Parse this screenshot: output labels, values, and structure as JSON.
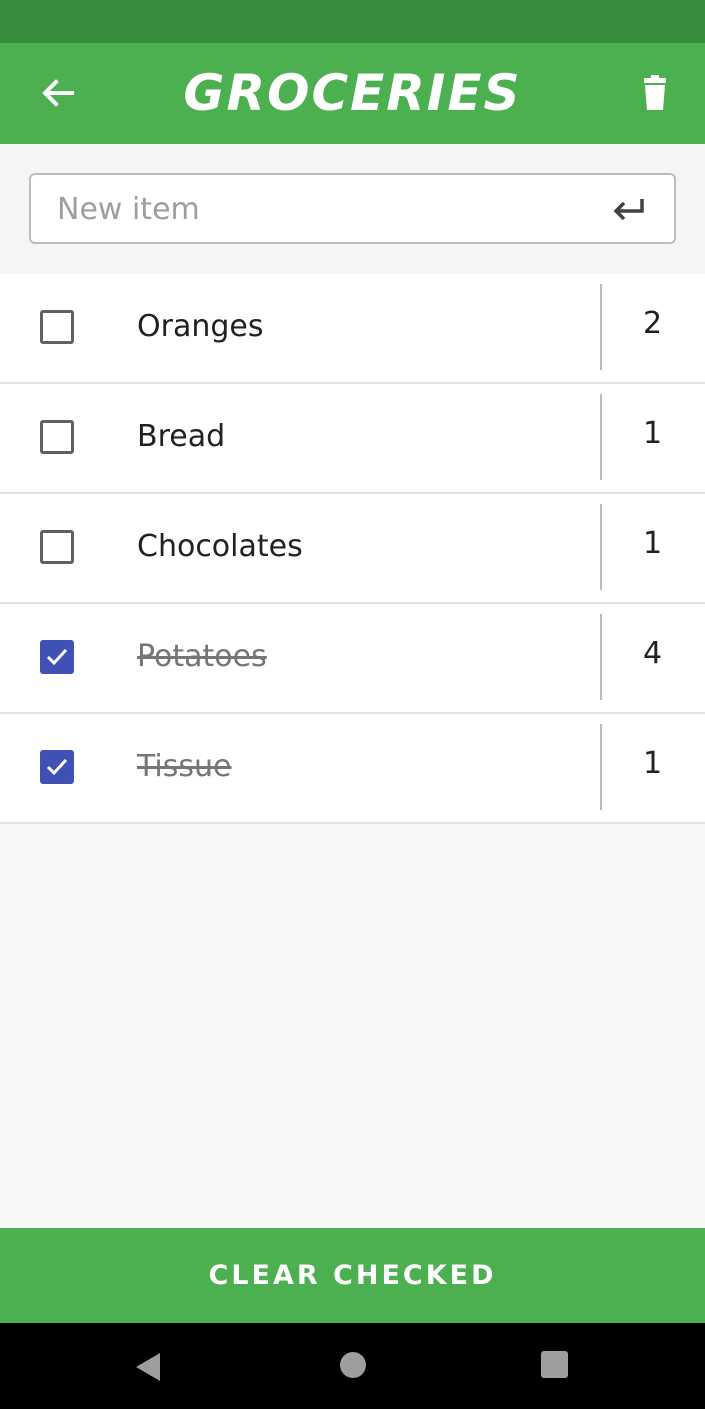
{
  "app_bar": {
    "title": "GROCERIES",
    "back_icon": "arrow-left-icon",
    "delete_icon": "trash-icon",
    "color": "#4caf50"
  },
  "new_item": {
    "placeholder": "New item",
    "value": "",
    "enter_icon": "enter-return-icon"
  },
  "items": [
    {
      "name": "Oranges",
      "quantity": "2",
      "checked": false
    },
    {
      "name": "Bread",
      "quantity": "1",
      "checked": false
    },
    {
      "name": "Chocolates",
      "quantity": "1",
      "checked": false
    },
    {
      "name": "Potatoes",
      "quantity": "4",
      "checked": true
    },
    {
      "name": "Tissue",
      "quantity": "1",
      "checked": true
    }
  ],
  "footer": {
    "clear_label": "CLEAR CHECKED"
  },
  "colors": {
    "accent": "#3f51b5",
    "status_bar": "#388e3c"
  }
}
